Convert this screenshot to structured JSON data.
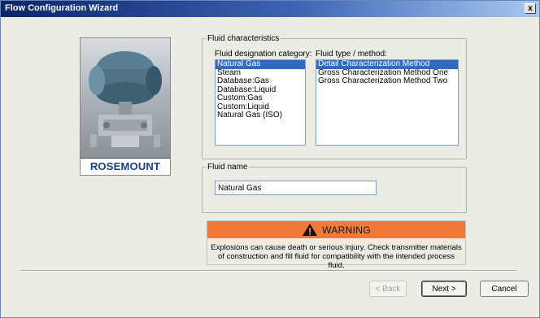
{
  "window": {
    "title": "Flow Configuration Wizard",
    "close_label": "x"
  },
  "image": {
    "brand_text": "ROSEMOUNT"
  },
  "fluid_characteristics": {
    "group_label": "Fluid characteristics",
    "category_label": "Fluid designation category:",
    "type_label": "Fluid type / method:",
    "categories": [
      "Natural Gas",
      "Steam",
      "Database:Gas",
      "Database:Liquid",
      "Custom:Gas",
      "Custom:Liquid",
      "Natural Gas (ISO)"
    ],
    "selected_category": "Natural Gas",
    "methods": [
      "Detail Characterization Method",
      "Gross Characterization Method One",
      "Gross Characterization Method Two"
    ],
    "selected_method": "Detail Characterization Method"
  },
  "fluid_name": {
    "group_label": "Fluid name",
    "value": "Natural Gas"
  },
  "warning": {
    "title": "WARNING",
    "message": "Explosions can cause death or serious injury. Check transmitter materials of construction and fill fluid for compatibility with the intended process fluid.",
    "bar_color": "#f07a3a",
    "icon": "warning-triangle-icon"
  },
  "buttons": {
    "back": "< Back",
    "next": "Next >",
    "cancel": "Cancel"
  },
  "colors": {
    "selection": "#316ac5",
    "brand": "#1a3f8a"
  }
}
